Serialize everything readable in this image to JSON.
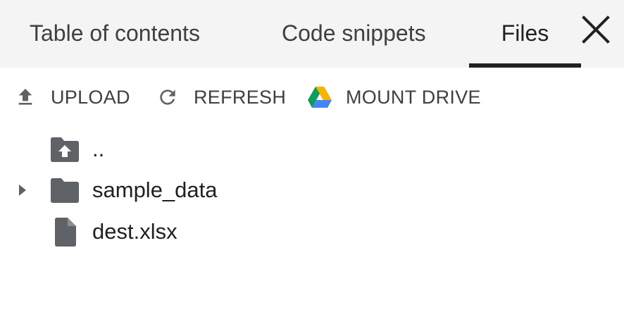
{
  "tabs": [
    {
      "label": "Table of contents",
      "active": false
    },
    {
      "label": "Code snippets",
      "active": false
    },
    {
      "label": "Files",
      "active": true
    }
  ],
  "close_icon": "close-icon",
  "toolbar": {
    "upload": {
      "label": "UPLOAD",
      "icon": "upload-icon"
    },
    "refresh": {
      "label": "REFRESH",
      "icon": "refresh-icon"
    },
    "mount_drive": {
      "label": "MOUNT DRIVE",
      "icon": "google-drive-icon"
    }
  },
  "files": [
    {
      "name": "..",
      "type": "parent-folder",
      "icon": "folder-up-icon",
      "expandable": false
    },
    {
      "name": "sample_data",
      "type": "folder",
      "icon": "folder-icon",
      "expandable": true,
      "expanded": false
    },
    {
      "name": "dest.xlsx",
      "type": "file",
      "icon": "file-icon",
      "expandable": false
    }
  ],
  "colors": {
    "tabbar_bg": "#f4f4f4",
    "text": "#202124",
    "muted_text": "#3c4043",
    "icon_gray": "#5f6368",
    "drive_green": "#0f9d58",
    "drive_yellow": "#f4b400",
    "drive_blue": "#4285f4"
  }
}
